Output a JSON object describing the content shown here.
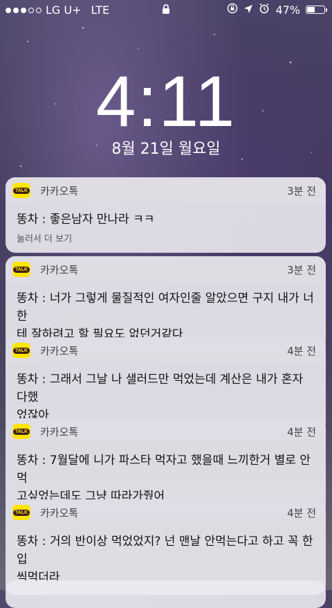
{
  "status": {
    "carrier": "LG U+",
    "network": "LTE",
    "battery": "47%",
    "battery_level": 0.47,
    "signal_bars": 3
  },
  "lock": {
    "time": "4:11",
    "date": "8월 21일 월요일"
  },
  "notifications": [
    {
      "app": "카카오톡",
      "time": "3분 전",
      "message": "똥차 : 좋은남자 만나라 ㅋㅋ",
      "hint": "눌러서 더 보기"
    },
    {
      "app": "카카오톡",
      "time": "3분 전",
      "message": "똥차 : 너가 그렇게 물질적인 여자인줄 알았으면 구지 내가 너한\n테 잘하려고 할 필요도 없던거같다"
    },
    {
      "app": "카카오톡",
      "time": "4분 전",
      "message": "똥차 : 그래서 그날 나 샐러드만 먹었는데 계산은 내가 혼자 다했\n었잖아"
    },
    {
      "app": "카카오톡",
      "time": "4분 전",
      "message": "똥차 : 7월달에 니가 파스타 먹자고 했을때 느끼한거 별로 안먹\n고싶었는데도 그냥 따라가줬어"
    },
    {
      "app": "카카오톡",
      "time": "4분 전",
      "message": "똥차 : 거의 반이상 먹었었지? 넌 맨날 안먹는다고 하고 꼭 한입\n씩먹더라"
    }
  ],
  "icons": {
    "app_icon": "kakaotalk-icon",
    "lock": "lock-icon",
    "orientation": "orientation-lock-icon",
    "location": "location-arrow-icon",
    "alarm": "alarm-icon"
  }
}
